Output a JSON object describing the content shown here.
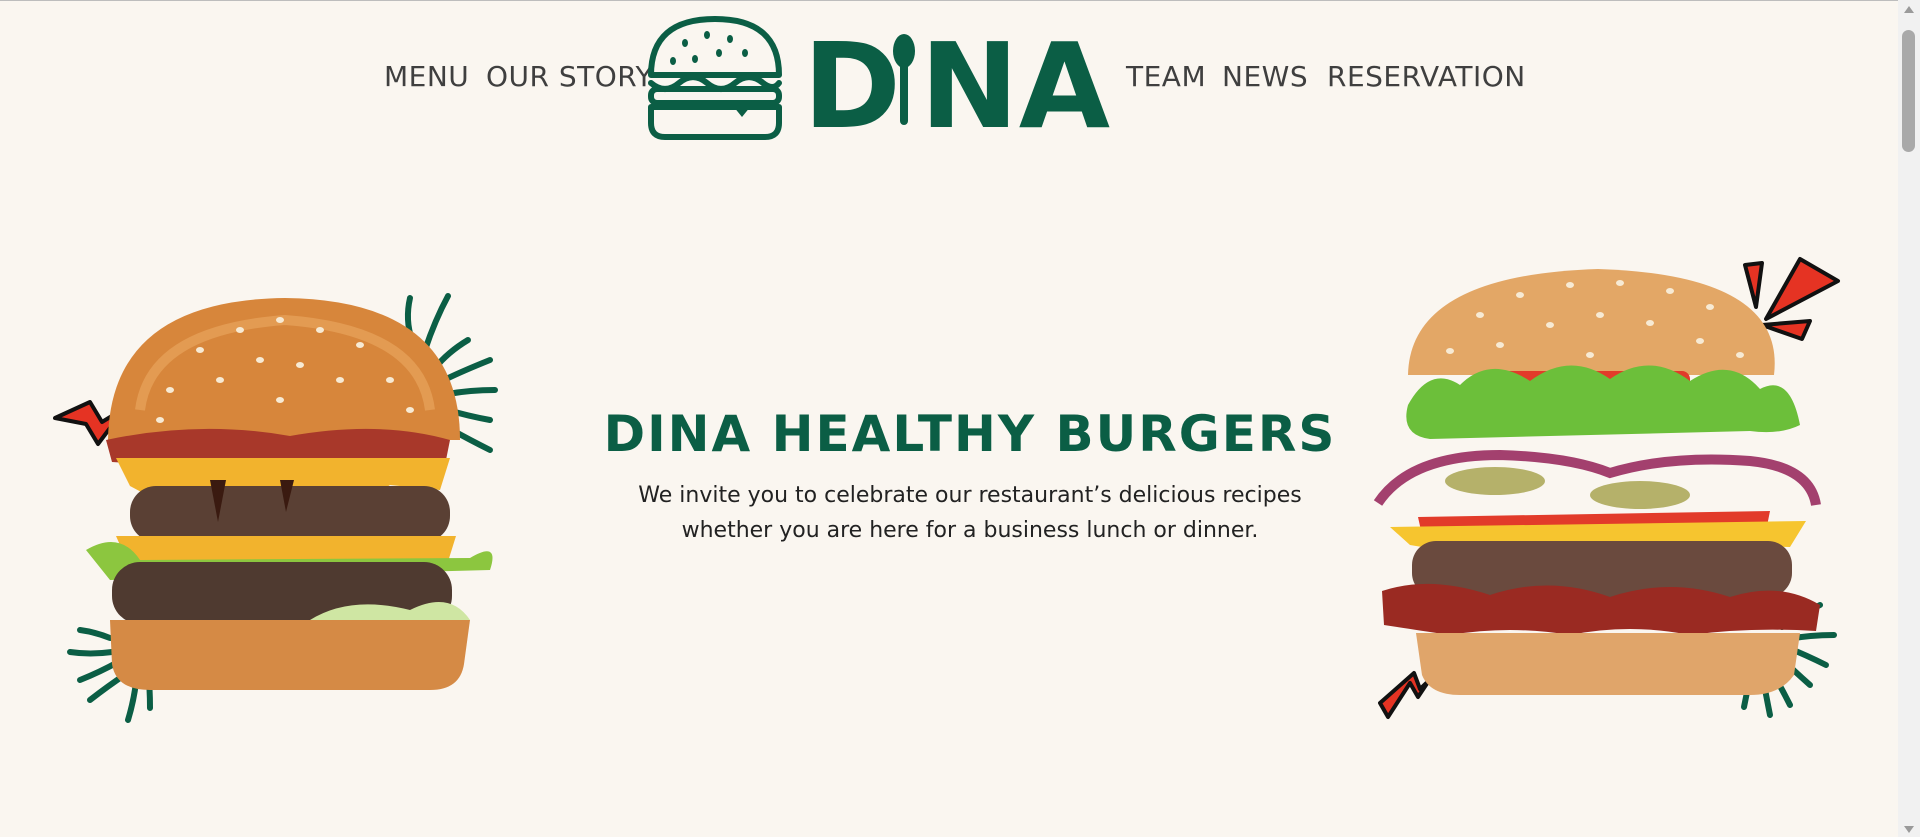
{
  "nav": {
    "left": [
      "MENU",
      "OUR STORY"
    ],
    "right": [
      "TEAM",
      "NEWS",
      "RESERVATION"
    ]
  },
  "logo": {
    "text": "DINA",
    "icon": "burger-icon"
  },
  "hero": {
    "title": "DINA HEALTHY BURGERS",
    "subtitle_line1": "We invite you to celebrate our restaurant’s delicious recipes",
    "subtitle_line2": "whether you are here for a business lunch or dinner."
  },
  "colors": {
    "brand_green": "#0b5e45",
    "background": "#faf6f0",
    "accent_red": "#e53323",
    "nav_text": "#3f3f3f"
  },
  "images": {
    "left_burger": "double-cheeseburger-image",
    "right_burger": "loaded-cheeseburger-image"
  }
}
